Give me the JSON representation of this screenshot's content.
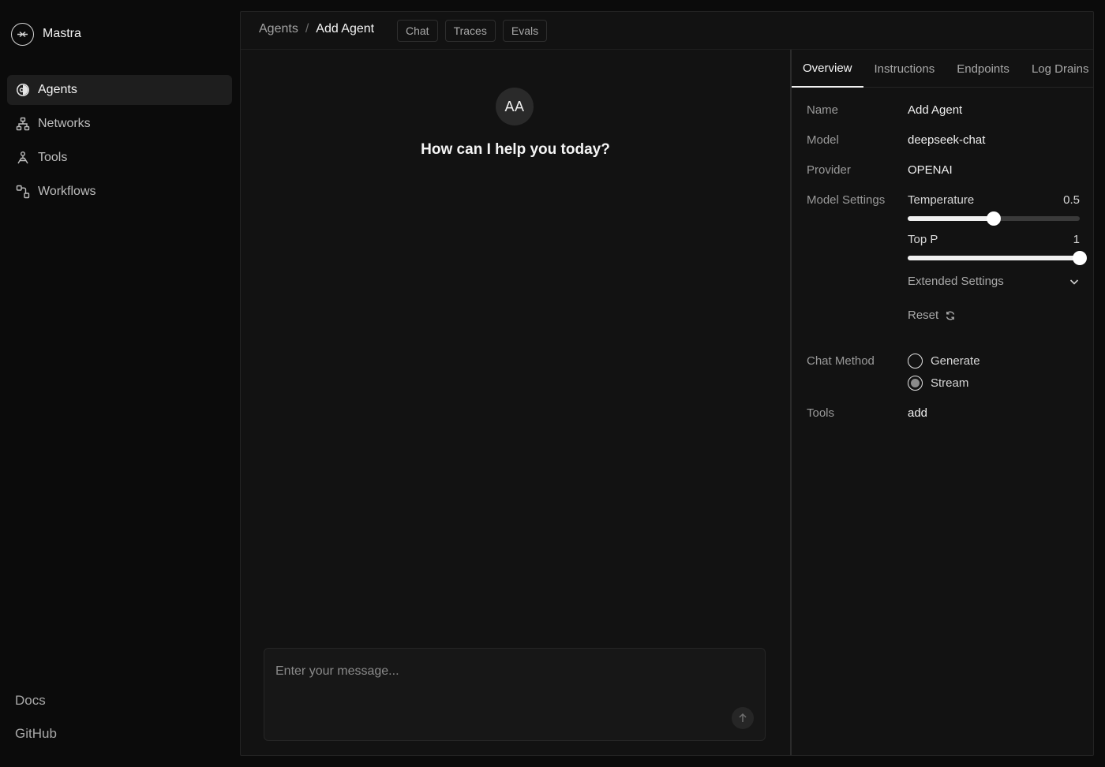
{
  "brand": {
    "name": "Mastra"
  },
  "sidebar": {
    "items": [
      {
        "label": "Agents",
        "icon": "agent-icon",
        "active": true
      },
      {
        "label": "Networks",
        "icon": "network-icon"
      },
      {
        "label": "Tools",
        "icon": "tool-icon"
      },
      {
        "label": "Workflows",
        "icon": "workflow-icon"
      }
    ],
    "bottom": {
      "docs": "Docs",
      "github": "GitHub"
    }
  },
  "header": {
    "breadcrumb": {
      "parent": "Agents",
      "separator": "/",
      "current": "Add Agent"
    },
    "tabs": [
      "Chat",
      "Traces",
      "Evals"
    ]
  },
  "chat": {
    "avatar_initials": "AA",
    "greeting": "How can I help you today?",
    "input_placeholder": "Enter your message...",
    "input_value": ""
  },
  "details": {
    "tabs": [
      {
        "label": "Overview",
        "active": true
      },
      {
        "label": "Instructions"
      },
      {
        "label": "Endpoints"
      },
      {
        "label": "Log Drains"
      }
    ],
    "name": {
      "label": "Name",
      "value": "Add Agent"
    },
    "model": {
      "label": "Model",
      "value": "deepseek-chat"
    },
    "provider": {
      "label": "Provider",
      "value": "OPENAI"
    },
    "model_settings": {
      "label": "Model Settings",
      "temperature": {
        "label": "Temperature",
        "value": "0.5",
        "fraction": 0.5
      },
      "top_p": {
        "label": "Top P",
        "value": "1",
        "fraction": 1.0
      },
      "extended_label": "Extended Settings",
      "reset_label": "Reset"
    },
    "chat_method": {
      "label": "Chat Method",
      "options": [
        "Generate",
        "Stream"
      ],
      "selected": "Stream"
    },
    "tools": {
      "label": "Tools",
      "value": "add"
    }
  },
  "colors": {
    "background": "#0b0b0b",
    "panel": "#121212",
    "active_nav": "#1e1e1e",
    "text_primary": "#f5f5f5",
    "text_muted": "#9a9a9a",
    "slider_fill": "#f0f0f0",
    "slider_track": "#3a3a3a"
  }
}
